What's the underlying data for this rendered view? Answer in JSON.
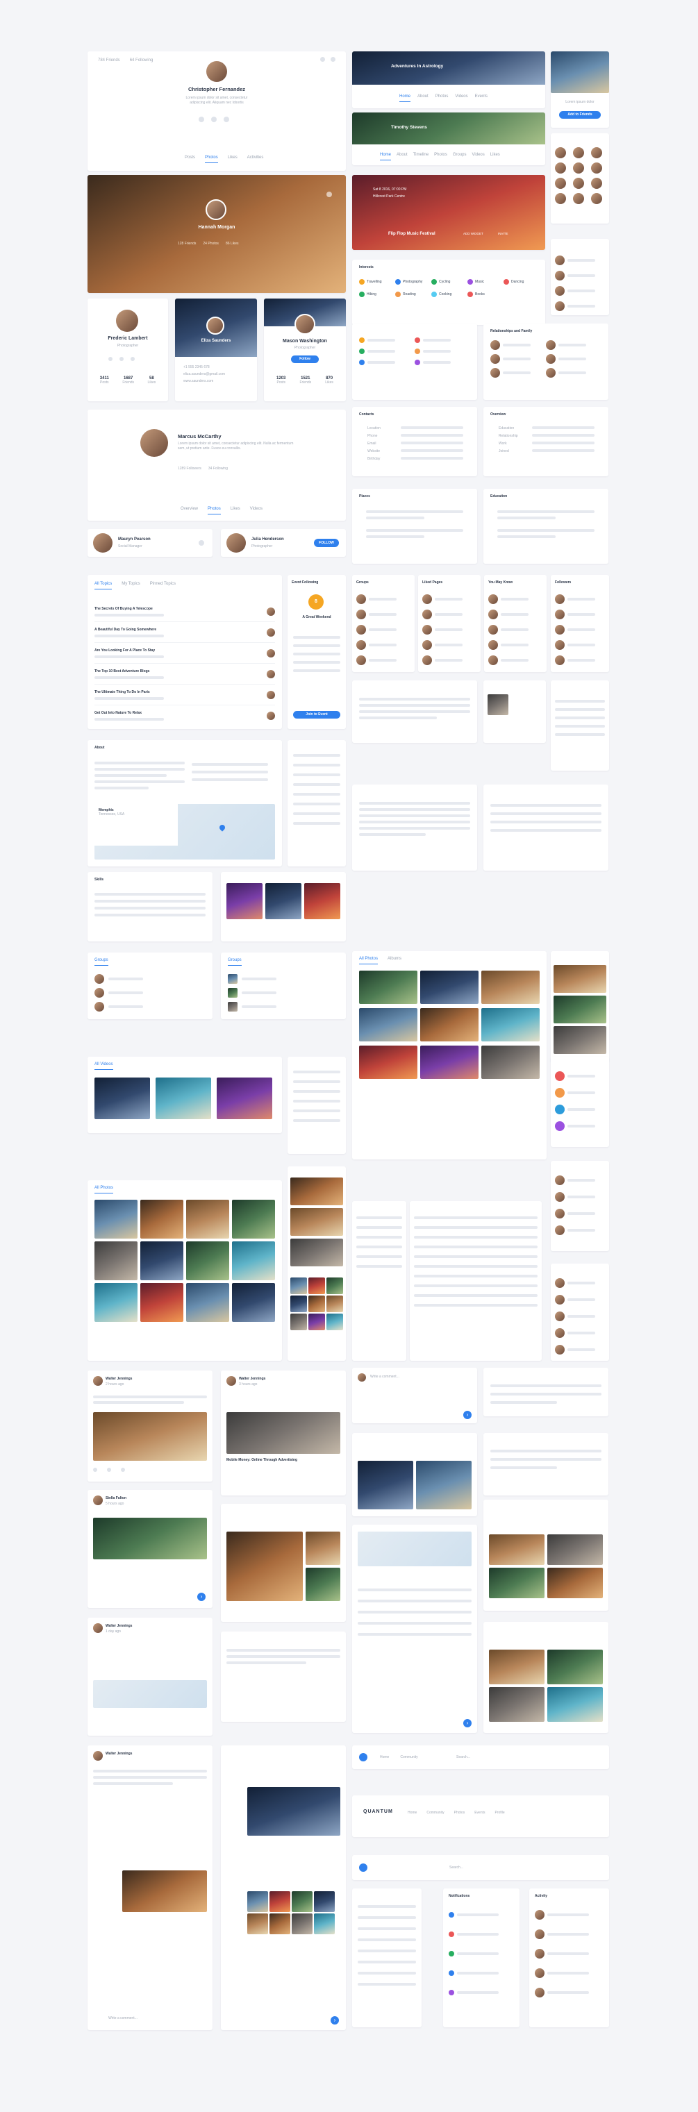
{
  "profile_main": {
    "top_left_1": "784 Friends",
    "top_left_2": "64 Following",
    "name": "Christopher Fernandez",
    "bio": "Lorem ipsum dolor sit amet, consectetur adipiscing elit. Aliquam nec lobortis",
    "tabs": [
      "Posts",
      "Photos",
      "Likes",
      "Activities"
    ]
  },
  "hero_profile": {
    "name": "Hannah Morgan",
    "role": "Traveller",
    "stats": [
      "128 Friends",
      "24 Photos",
      "86 Likes"
    ]
  },
  "small_profiles": [
    {
      "name": "Frederic Lambert",
      "role": "Photographer",
      "stats": [
        "3411",
        "1687",
        "58"
      ],
      "labels": [
        "Posts",
        "Friends",
        "Likes"
      ]
    },
    {
      "name": "Eliza Saunders",
      "phone": "+1 555 2345 678",
      "email": "eliza.saunders@gmail.com",
      "site": "www.saunders.com"
    },
    {
      "name": "Mason Washington",
      "role": "Photographer",
      "button": "Follow",
      "stats": [
        "1203",
        "1521",
        "870"
      ],
      "labels": [
        "Posts",
        "Friends",
        "Likes"
      ]
    }
  ],
  "marcus": {
    "name": "Marcus McCarthy",
    "bio": "Lorem ipsum dolor sit amet, consectetur adipiscing elit. Nulla ac fermentum sem, ut pretium ante. Fusce eu convallis.",
    "stats": [
      "1289 Followers",
      "34 Following"
    ],
    "tabs": [
      "Overview",
      "Photos",
      "Likes",
      "Videos"
    ]
  },
  "follow_row": [
    {
      "name": "Mauryn Pearson",
      "role": "Social Manager"
    },
    {
      "name": "Julia Henderson",
      "role": "Photographer",
      "button": "FOLLOW"
    }
  ],
  "banners": [
    {
      "title": "Adventures In Astrology",
      "tabs": [
        "Home",
        "About",
        "Photos",
        "Videos",
        "Events"
      ]
    },
    {
      "title": "Timothy Stevens",
      "tabs": [
        "Home",
        "About",
        "Timeline",
        "Photos",
        "Groups",
        "Videos",
        "Likes"
      ]
    }
  ],
  "side_cta": {
    "text": "Lorem ipsum dolor",
    "button": "Add to Friends"
  },
  "event_banner": {
    "date": "Sat 8 2016, 07:00 PM",
    "place": "Hillcrest Park Centre",
    "title": "Flip Flop Music Festival",
    "action1": "ADD WIDGET",
    "action2": "INVITE"
  },
  "interests_card": {
    "title": "Interests",
    "items": [
      "Travelling",
      "Photography",
      "Cycling",
      "Music",
      "Dancing",
      "Hiking",
      "Reading",
      "Cooking",
      "Books"
    ]
  },
  "relatives_card": {
    "title": "Relationships and Family"
  },
  "contacts_card": {
    "title": "Contacts",
    "rows": [
      "Location",
      "Phone",
      "Email",
      "Website",
      "Birthday"
    ]
  },
  "overview_card": {
    "title": "Overview",
    "rows": [
      "Education",
      "Relationship",
      "Work",
      "Joined"
    ]
  },
  "places_card": {
    "title": "Places"
  },
  "education_card": {
    "title": "Education"
  },
  "friends_lists": [
    "Groups",
    "Liked Pages",
    "You May Know",
    "Followers"
  ],
  "forum": {
    "tabs": [
      "All Topics",
      "My Topics",
      "Pinned Topics"
    ],
    "topics": [
      "The Secrets Of Buying A Telescope",
      "A Beautiful Day To Going Somewhere",
      "Are You Looking For A Place To Stay",
      "The Top 10 Best Adventure Blogs",
      "The Ultimate Thing To Do In Paris",
      "Get Out Into Nature To Relax"
    ]
  },
  "event_card": {
    "title": "Event Following",
    "date": "8",
    "text": "A Great Weekend",
    "button": "Join to Event"
  },
  "about_card": {
    "title": "About"
  },
  "skills_card": {
    "title": "Skills"
  },
  "map_card": {
    "title": "Memphis",
    "sub": "Tennessee, USA"
  },
  "photos_tabs": [
    "All Photos",
    "Albums"
  ],
  "videos_card": {
    "title": "All Videos"
  },
  "feed": {
    "posts": [
      {
        "name": "Walter Jennings",
        "time": "2 hours ago"
      },
      {
        "name": "Walter Jennings",
        "time": "3 hours ago"
      },
      {
        "name": "Stella Fulton",
        "time": "5 hours ago"
      },
      {
        "name": "Walter Jennings",
        "time": "1 day ago"
      }
    ],
    "post_title": "Mobile Money: Online Through Advertising",
    "comment_placeholder": "Write a comment..."
  },
  "nav_bar": {
    "brand": "QUANTUM",
    "items": [
      "Home",
      "Community",
      "Photos",
      "Events",
      "Profile"
    ],
    "search": "Search..."
  },
  "notifications": {
    "title": "Notifications"
  },
  "activity": {
    "title": "Activity"
  },
  "colors": {
    "accent": "#2f80ed",
    "bg": "#f4f5f8",
    "card": "#ffffff"
  }
}
